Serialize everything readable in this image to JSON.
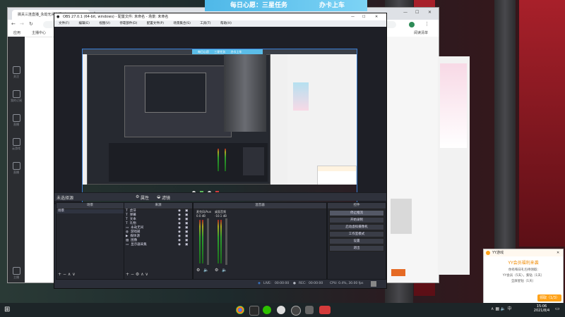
{
  "browser": {
    "tab_title": "搞关三连直播_永劫无间直播_虎",
    "bookmarks": [
      "应用",
      "主播中心"
    ],
    "reading_list": "阅读清单"
  },
  "yy_sidebar": {
    "items": [
      "关注",
      "我的订阅",
      "直播",
      "云游戏",
      "直播"
    ],
    "bottom": "主播"
  },
  "banner": {
    "text_left": "每日心愿：三星任务",
    "text_right": "办卡上车"
  },
  "obs": {
    "title": "OBS 27.0.1 (64-bit, windows) - 配置文件: 未命名 - 场景: 未命名",
    "menu": [
      "文件(F)",
      "编辑(E)",
      "视图(V)",
      "停靠部件(D)",
      "配置文件(P)",
      "场景集合(S)",
      "工具(T)",
      "帮助(H)"
    ],
    "preview_badges": [
      "每日心愿",
      "三星任务",
      "办卡上车"
    ],
    "source_toolbar": {
      "label": "未选择源",
      "properties": "属性",
      "filters": "滤镜"
    },
    "docks": {
      "scenes": {
        "title": "场景",
        "items": [
          "场景"
        ]
      },
      "sources": {
        "title": "来源",
        "items": [
          "虎牙",
          "弹幕",
          "文本",
          "礼物",
          "永劫无间",
          "游戏捕",
          "媒体源",
          "图像",
          "显示器采集"
        ]
      },
      "mixer": {
        "title": "混音器",
        "channels": [
          {
            "name": "麦克风/Aux",
            "db": "0.0 dB"
          },
          {
            "name": "桌面音频",
            "db": "-10.1 dB"
          }
        ]
      },
      "controls": {
        "title": "控件",
        "buttons": [
          "停止推流",
          "开始录制",
          "启动虚拟摄像机",
          "工作室模式",
          "设置",
          "退出"
        ]
      }
    },
    "status": {
      "live_label": "LIVE:",
      "live_time": "00:00:00",
      "rec_label": "REC:",
      "rec_time": "00:00:00",
      "cpu": "CPU: 0.4%, 30.00 fps"
    }
  },
  "yy_popup": {
    "app": "YY游戏",
    "headline": "YY会员福利来袭",
    "line1": "你有每日礼包待领取:",
    "line2": "YY会员（5天），紫钻（1天）",
    "line3": "全屏星钻（1天）",
    "button": "领取（1/3）"
  },
  "taskbar": {
    "time": "15:06",
    "date": "2021/8/4"
  },
  "colors": {
    "obs_bg": "#2b2e38",
    "banner": "#4fb8e8",
    "accent_orange": "#ffa31a",
    "selection_blue": "#3a7fd5"
  }
}
